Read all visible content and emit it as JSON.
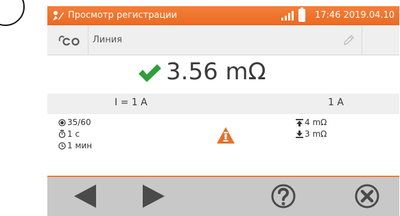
{
  "status_bar": {
    "title": "Просмотр регистрации",
    "clock": "17:46 2019.04.10",
    "accent_color": "#f07a30"
  },
  "line_bar": {
    "label": "Линия",
    "icons": [
      "loop-icon",
      "pencil-icon"
    ]
  },
  "result": {
    "value": "3.56 mΩ",
    "status_color": "#2e9e3a"
  },
  "current_bar": {
    "left": "I = 1 A",
    "right": "1 A"
  },
  "details": {
    "count": "35/60",
    "time_c": "1 c",
    "time_min": "1 мин",
    "upper_limit": "4 mΩ",
    "lower_limit": "3 mΩ"
  },
  "toolbar": {
    "buttons": [
      "back-button",
      "forward-button",
      "help-button",
      "close-button"
    ]
  }
}
